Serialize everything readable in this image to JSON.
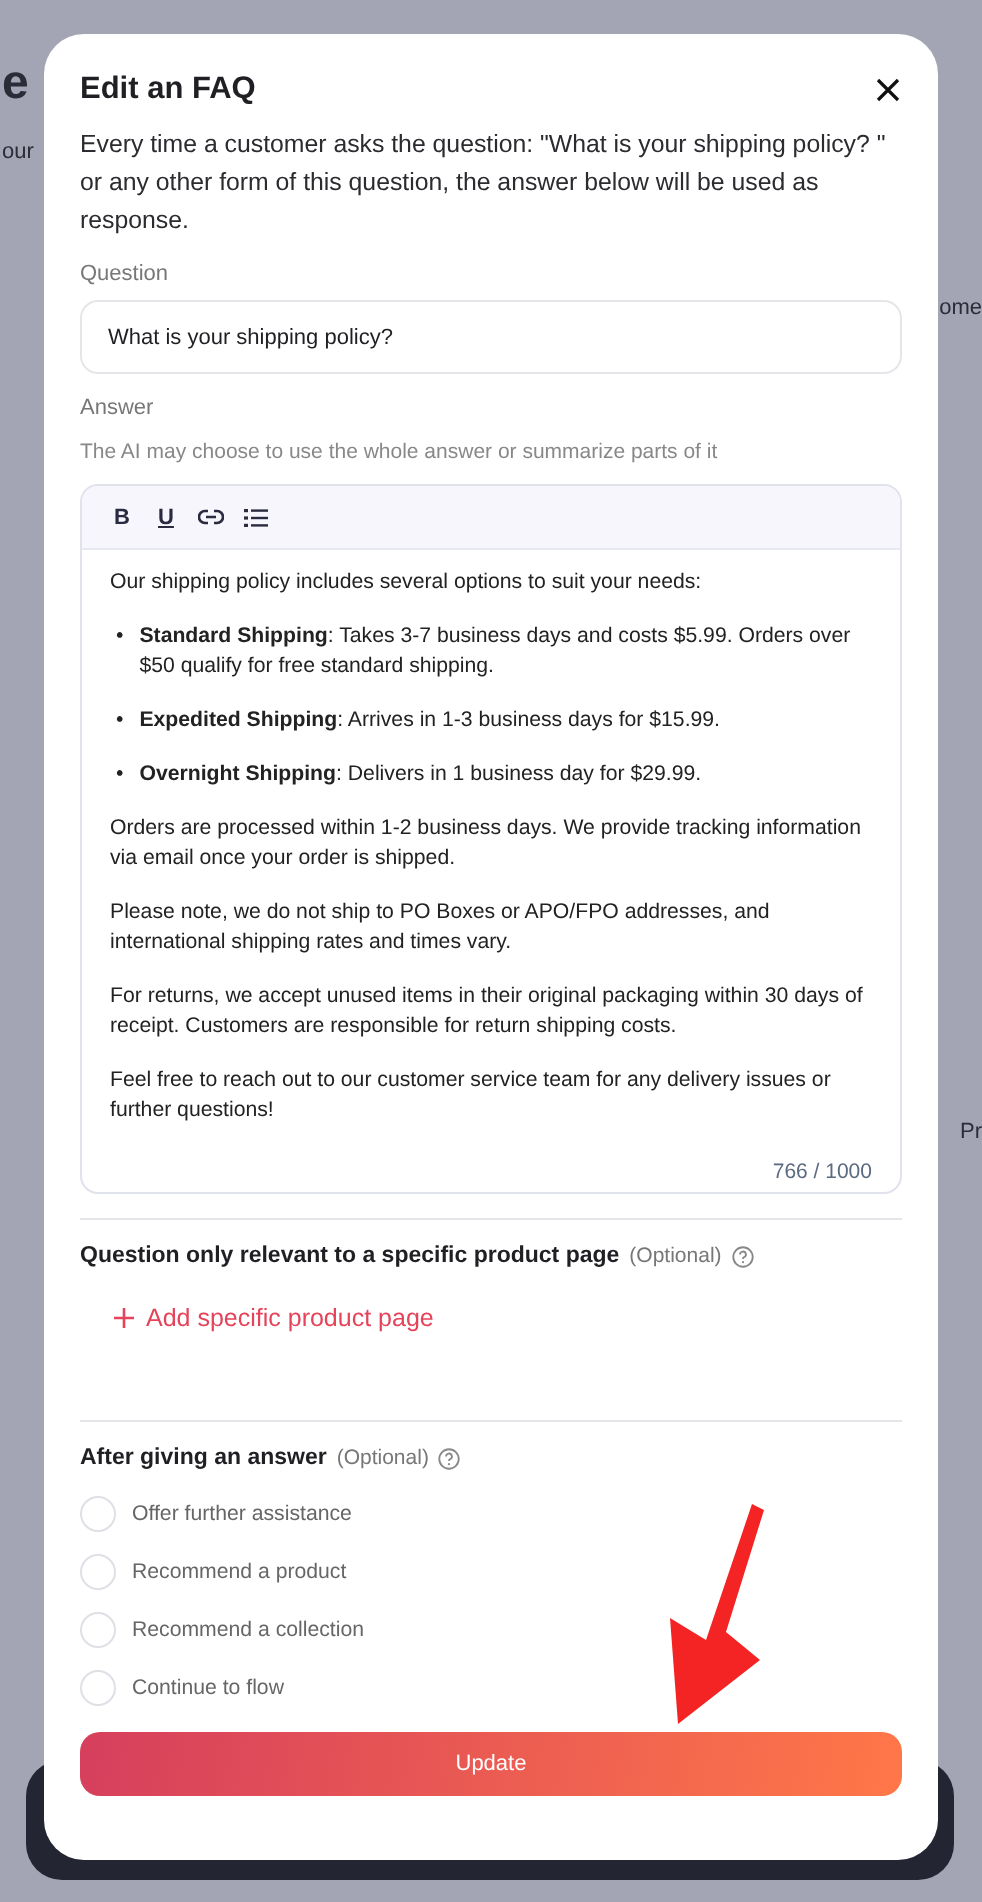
{
  "background": {
    "left_fragments": [
      "e",
      "our"
    ],
    "right_fragments": [
      "ome",
      "Pr"
    ]
  },
  "modal": {
    "title": "Edit an FAQ",
    "description": "Every time a customer asks the question: \"What is your shipping policy? \" or any other form of this question, the answer below will be used as response.",
    "question": {
      "label": "Question",
      "value": "What is your shipping policy?"
    },
    "answer": {
      "label": "Answer",
      "hint": "The AI may choose to use the whole answer or summarize parts of it",
      "toolbar": [
        {
          "kind": "bold",
          "text": "B"
        },
        {
          "kind": "underline",
          "text": "U"
        },
        {
          "kind": "link"
        },
        {
          "kind": "list"
        }
      ],
      "blocks": [
        {
          "kind": "paragraph",
          "text": "Our shipping policy includes several options to suit your needs:"
        },
        {
          "kind": "bullet",
          "marker": "•",
          "text": "**Standard Shipping**: Takes 3-7 business days and costs $5.99. Orders over $50 qualify for free standard shipping."
        },
        {
          "kind": "bullet",
          "marker": "•",
          "text": "**Expedited Shipping**: Arrives in 1-3 business days for $15.99."
        },
        {
          "kind": "bullet",
          "marker": "•",
          "text": "**Overnight Shipping**: Delivers in 1 business day for $29.99."
        },
        {
          "kind": "paragraph",
          "text": "Orders are processed within 1-2 business days. We provide tracking information via email once your order is shipped."
        },
        {
          "kind": "paragraph",
          "text": "Please note, we do not ship to PO Boxes or APO/FPO addresses, and international shipping rates and times vary."
        },
        {
          "kind": "paragraph",
          "text": "For returns, we accept unused items in their original packaging within 30 days of receipt. Customers are responsible for return shipping costs."
        },
        {
          "kind": "paragraph",
          "text": "Feel free to reach out to our customer service team for any delivery issues or further questions!"
        }
      ],
      "counter": "766 / 1000"
    },
    "product_section": {
      "title": "Question only relevant to a specific product page",
      "optional": "(Optional)",
      "add_link": "Add specific product page"
    },
    "after_section": {
      "title": "After giving an answer",
      "optional": "(Optional)",
      "options": [
        {
          "label": "Offer further assistance",
          "checked": false
        },
        {
          "label": "Recommend a product",
          "checked": false
        },
        {
          "label": "Recommend a collection",
          "checked": false
        },
        {
          "label": "Continue to flow",
          "checked": false
        }
      ]
    },
    "button": "Update"
  }
}
